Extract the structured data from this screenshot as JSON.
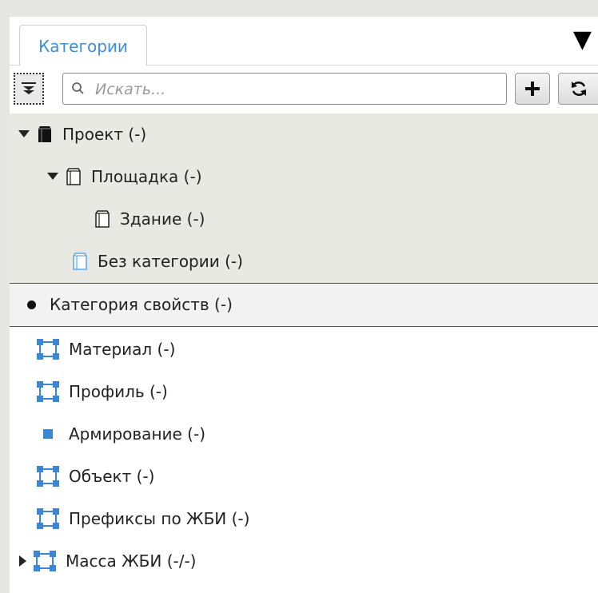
{
  "tab": {
    "label": "Категории"
  },
  "search": {
    "placeholder": "Искать..."
  },
  "tree": {
    "project": "Проект (-)",
    "site": "Площадка (-)",
    "building": "Здание (-)",
    "uncategorized": "Без категории (-)",
    "property_category": "Категория свойств (-)",
    "material": "Материал (-)",
    "profile": "Профиль (-)",
    "reinforcement": "Армирование (-)",
    "object": "Объект (-)",
    "prefixes": "Префиксы по ЖБИ (-)",
    "mass": "Масса ЖБИ (-/-)"
  },
  "colors": {
    "accent": "#3d8fd8",
    "icon_blue": "#3d86d4",
    "tree_bg": "#e9e9e4"
  },
  "icons": {
    "toolbar": [
      "collapse-all-icon",
      "search-icon",
      "plus-icon",
      "refresh-icon"
    ],
    "tree": [
      "box-filled-icon",
      "box-outline-icon",
      "box-blue-outline-icon",
      "bullet-icon",
      "frame-blue-icon",
      "square-blue-icon"
    ]
  }
}
